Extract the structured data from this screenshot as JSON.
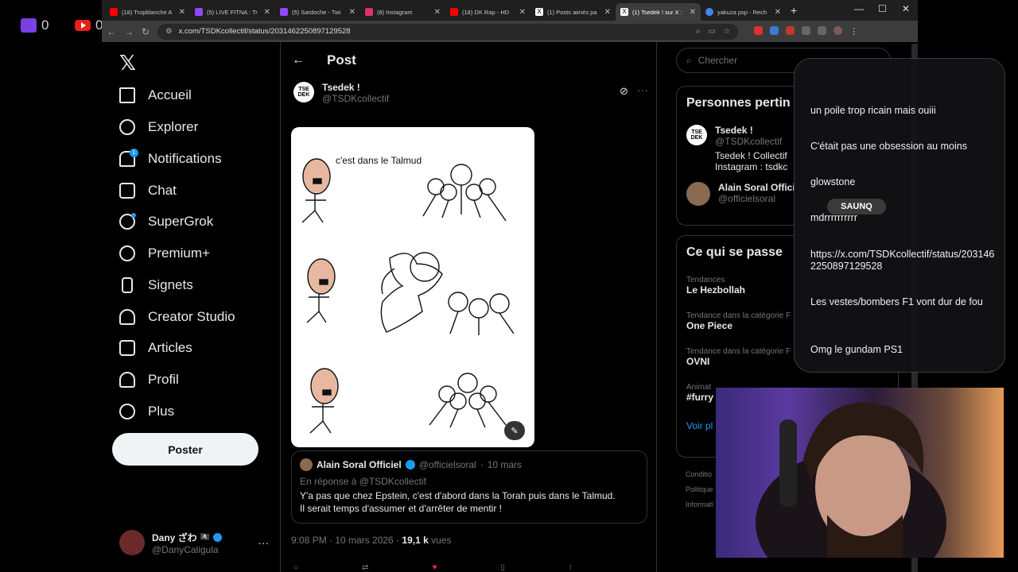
{
  "overlay": {
    "twitch_count": "0",
    "youtube_count": "0"
  },
  "browser": {
    "tabs": [
      {
        "title": "(18) Tropblanche A",
        "color": "#ff0000"
      },
      {
        "title": "(5) LIVE FITNA : Tr",
        "color": "#9146ff"
      },
      {
        "title": "(5) Sardoche - Twi",
        "color": "#9146ff"
      },
      {
        "title": "(8) Instagram",
        "color": "#e1306c"
      },
      {
        "title": "(18) DK Rap - HD",
        "color": "#ff0000"
      },
      {
        "title": "(1) Posts aimés pa",
        "color": "#ffffff"
      },
      {
        "title": "(1) Tsedek ! sur X :",
        "color": "#ffffff"
      },
      {
        "title": "yakuza psp - Rech",
        "color": "#4285f4"
      }
    ],
    "url": "x.com/TSDKcollectif/status/2031462250897129528"
  },
  "nav": {
    "items": [
      "Accueil",
      "Explorer",
      "Notifications",
      "Chat",
      "SuperGrok",
      "Premium+",
      "Signets",
      "Creator Studio",
      "Articles",
      "Profil",
      "Plus"
    ],
    "notif_badge": "1",
    "post_button": "Poster",
    "user_name": "Dany ざわ",
    "user_handle": "@DanyCaligula"
  },
  "post": {
    "header": "Post",
    "author_name": "Tsedek !",
    "author_handle": "@TSDKcollectif",
    "avatar_text": "TSE DEK",
    "media_caption": "c'est dans le Talmud",
    "quote": {
      "name": "Alain Soral Officiel",
      "handle": "@officielsoral",
      "date": "10 mars",
      "reply_to": "En réponse à @TSDKcollectif",
      "text1": "Y'a pas que chez Epstein, c'est d'abord dans la Torah puis dans le Talmud.",
      "text2": "Il serait temps d'assumer et d'arrêter de mentir !"
    },
    "meta_time": "9:08 PM · 10 mars 2026 ·",
    "meta_views": "19,1 k",
    "meta_views_label": "vues"
  },
  "right": {
    "search_placeholder": "Chercher",
    "people_title": "Personnes pertin",
    "p1_name": "Tsedek !",
    "p1_handle": "@TSDKcollectif",
    "p1_bio1": "Tsedek ! Collectif",
    "p1_bio2": "Instagram : tsdkc",
    "p2_name": "Alain Soral Offici",
    "p2_handle": "@officielsoral",
    "trends_title": "Ce qui se passe",
    "trends": [
      {
        "cat": "Tendances",
        "name": "Le Hezbollah"
      },
      {
        "cat": "Tendance dans la catégorie F",
        "name": "One Piece"
      },
      {
        "cat": "Tendance dans la catégorie F",
        "name": "OVNI"
      },
      {
        "cat": "Animat",
        "name": "#furry"
      }
    ],
    "see_more": "Voir pl",
    "footer1": "Conditio",
    "footer2": "Politique",
    "footer3": "Informati"
  },
  "chat": {
    "messages": [
      "un poile trop ricain mais ouiii",
      "C'était pas une obsession au moins",
      "glowstone",
      "mdrrrrrrrrrr",
      "https://x.com/TSDKcollectif/status/2031462250897129528",
      "Les vestes/bombers F1 vont dur de fou",
      "Omg le gundam PS1"
    ],
    "badge": "SAUNQ"
  }
}
